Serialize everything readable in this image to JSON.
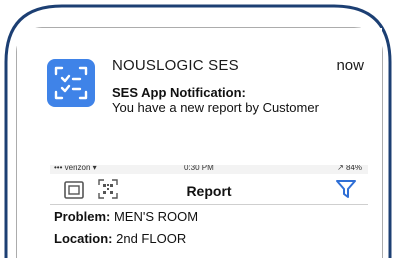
{
  "notification": {
    "app_name": "NOUSLOGIC SES",
    "time": "now",
    "title": "SES App Notification:",
    "body": "You have a new report by Customer",
    "app_icon": "checklist-icon",
    "icon_color": "#3f83e8"
  },
  "app_screenshot": {
    "status_left": "••• verizon ▾",
    "status_center": "0:30 PM",
    "status_right": "↗ 84%",
    "toolbar": {
      "title": "Report",
      "left_icons": [
        "screen-icon",
        "qr-code-icon"
      ],
      "right_icon": "filter-icon",
      "accent": "#2f6fd6"
    },
    "fields": [
      {
        "label": "Problem:",
        "value": "MEN'S ROOM"
      },
      {
        "label": "Location:",
        "value": "2nd FLOOR"
      }
    ]
  },
  "colors": {
    "frame": "#1c3f73"
  }
}
